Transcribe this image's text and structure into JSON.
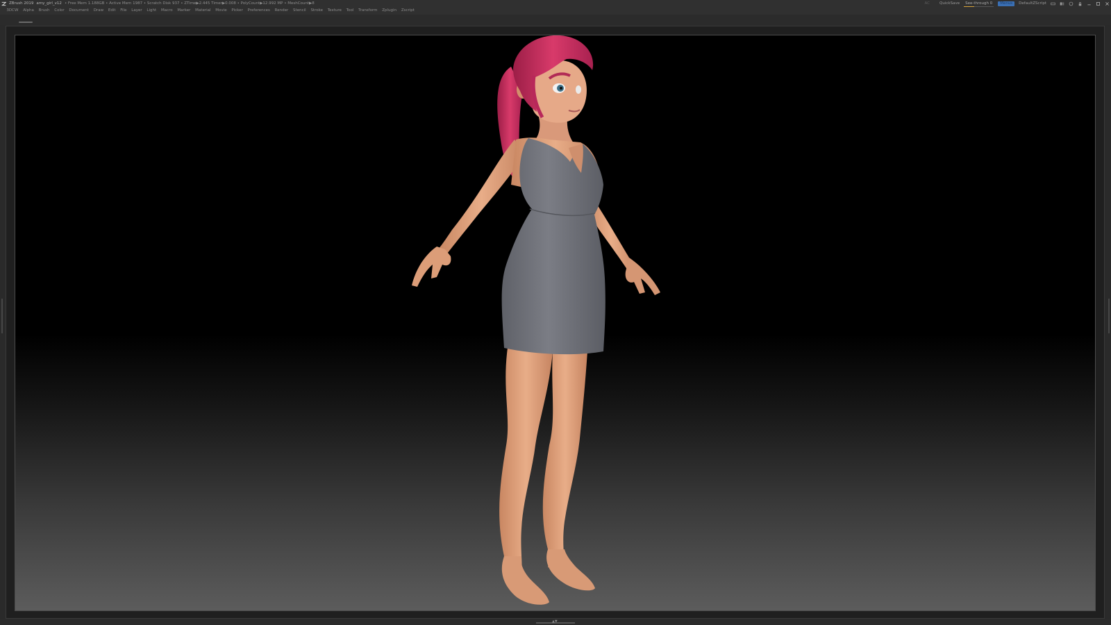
{
  "titlebar": {
    "app_name": "ZBrush 2019",
    "file_name": "amy_girl_v12",
    "stats": "• Free Mem 1.188GB • Active Mem 1987 • Scratch Disk 937 • ZTime▶2.445 Timer▶0.008 • PolyCount▶12.992 MP • MeshCount▶8",
    "ac_label": "AC",
    "quicksave_label": "QuickSave",
    "seethrough_label": "See-through",
    "seethrough_value": "0",
    "seethrough_fraction": 0.35,
    "menus_label": "Menus",
    "script_label": "DefaultZScript"
  },
  "menubar": {
    "items": [
      "3DCW",
      "Alpha",
      "Brush",
      "Color",
      "Document",
      "Draw",
      "Edit",
      "File",
      "Layer",
      "Light",
      "Macro",
      "Marker",
      "Material",
      "Movie",
      "Picker",
      "Preferences",
      "Render",
      "Stencil",
      "Stroke",
      "Texture",
      "Tool",
      "Transform",
      "Zplugin",
      "Zscript"
    ]
  },
  "icons": {
    "logo": "zbrush-logo-icon",
    "window_controls": [
      "minimize-icon",
      "restore-icon",
      "close-icon"
    ]
  },
  "colors": {
    "hair": "#c8305e",
    "skin": "#e2a07c",
    "dress": "#6e7077",
    "canvas_top": "#000000",
    "canvas_bottom": "#5c5c5c",
    "menus_button": "#3a6fb3"
  }
}
